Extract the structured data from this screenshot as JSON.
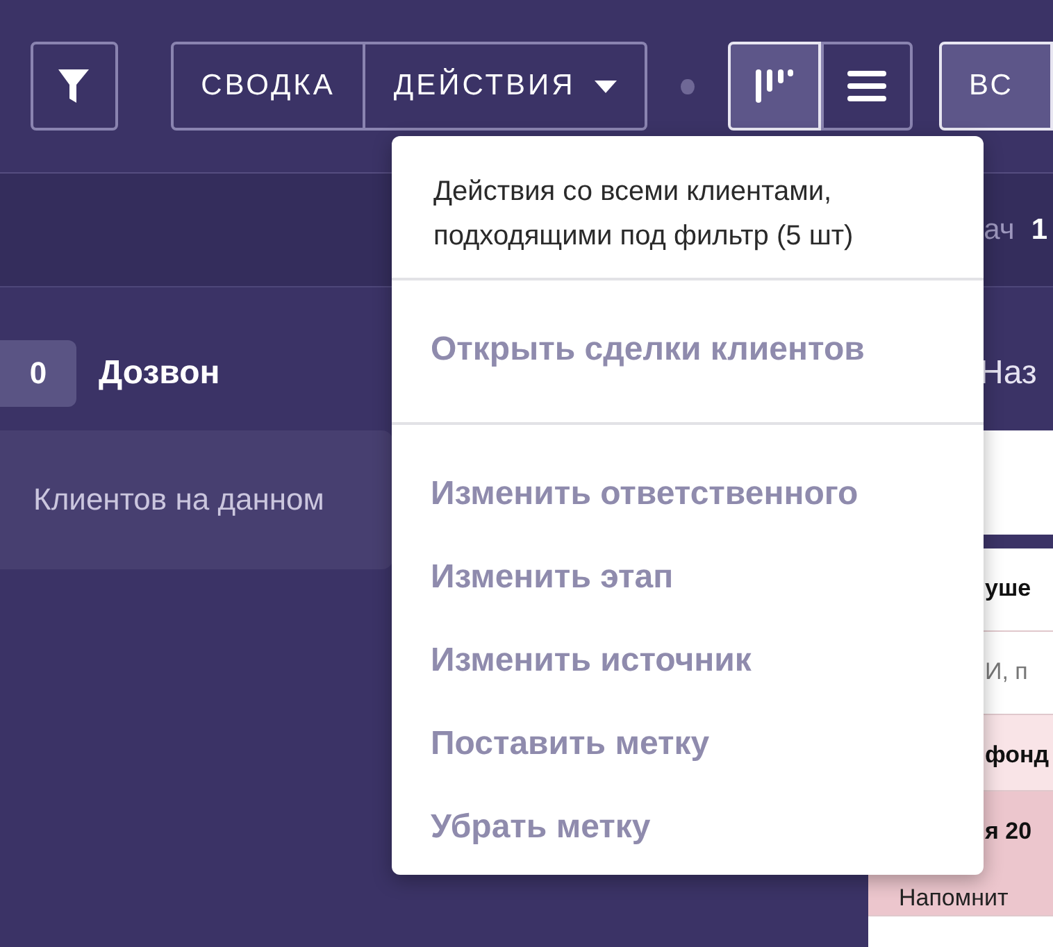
{
  "toolbar": {
    "segments": [
      {
        "label": "СВОДКА",
        "has_caret": false
      },
      {
        "label": "ДЕЙСТВИЯ",
        "has_caret": true
      }
    ],
    "views": [
      {
        "kind": "kanban",
        "selected": true
      },
      {
        "kind": "list",
        "selected": false
      }
    ],
    "all_button": "ВС"
  },
  "subbar": {
    "label": "ач",
    "value": "1"
  },
  "left_column": {
    "count": "0",
    "title": "Дозвон",
    "empty_text": "Клиентов на данном"
  },
  "right_column": {
    "title": "Наз",
    "rows": [
      {
        "kind": "header",
        "text": "уше"
      },
      {
        "kind": "plain",
        "text": "И, п"
      },
      {
        "kind": "highlight",
        "text": "фонд"
      },
      {
        "kind": "strong",
        "text": "я 20",
        "subtext": "Напомнит"
      }
    ]
  },
  "dropdown": {
    "title": "Действия со всеми клиентами, подходящими под фильтр (5 шт)",
    "groups": [
      {
        "items": [
          {
            "label": "Открыть сделки клиентов",
            "disabled": true
          }
        ]
      },
      {
        "items": [
          {
            "label": "Изменить ответственного",
            "disabled": true
          },
          {
            "label": "Изменить этап",
            "disabled": true
          },
          {
            "label": "Изменить источник",
            "disabled": true
          },
          {
            "label": "Поставить метку",
            "disabled": true
          },
          {
            "label": "Убрать метку",
            "disabled": true
          }
        ]
      }
    ]
  }
}
